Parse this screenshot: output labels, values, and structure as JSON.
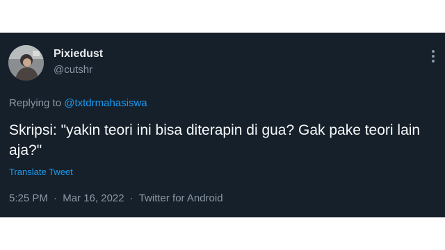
{
  "tweet": {
    "display_name": "Pixiedust",
    "handle": "@cutshr",
    "replying_prefix": "Replying to",
    "replying_to": "@txtdrmahasiswa",
    "text": "Skripsi: \"yakin teori ini bisa diterapin di gua? Gak pake teori lain aja?\"",
    "translate_label": "Translate Tweet",
    "time": "5:25 PM",
    "date": "Mar 16, 2022",
    "source": "Twitter for Android",
    "separator": "·"
  },
  "icons": {
    "avatar": "profile-photo",
    "more": "more-options-icon"
  },
  "colors": {
    "background": "#15202b",
    "text": "#e7e9ea",
    "secondary_text": "#8b98a5",
    "accent": "#1d9bf0"
  }
}
